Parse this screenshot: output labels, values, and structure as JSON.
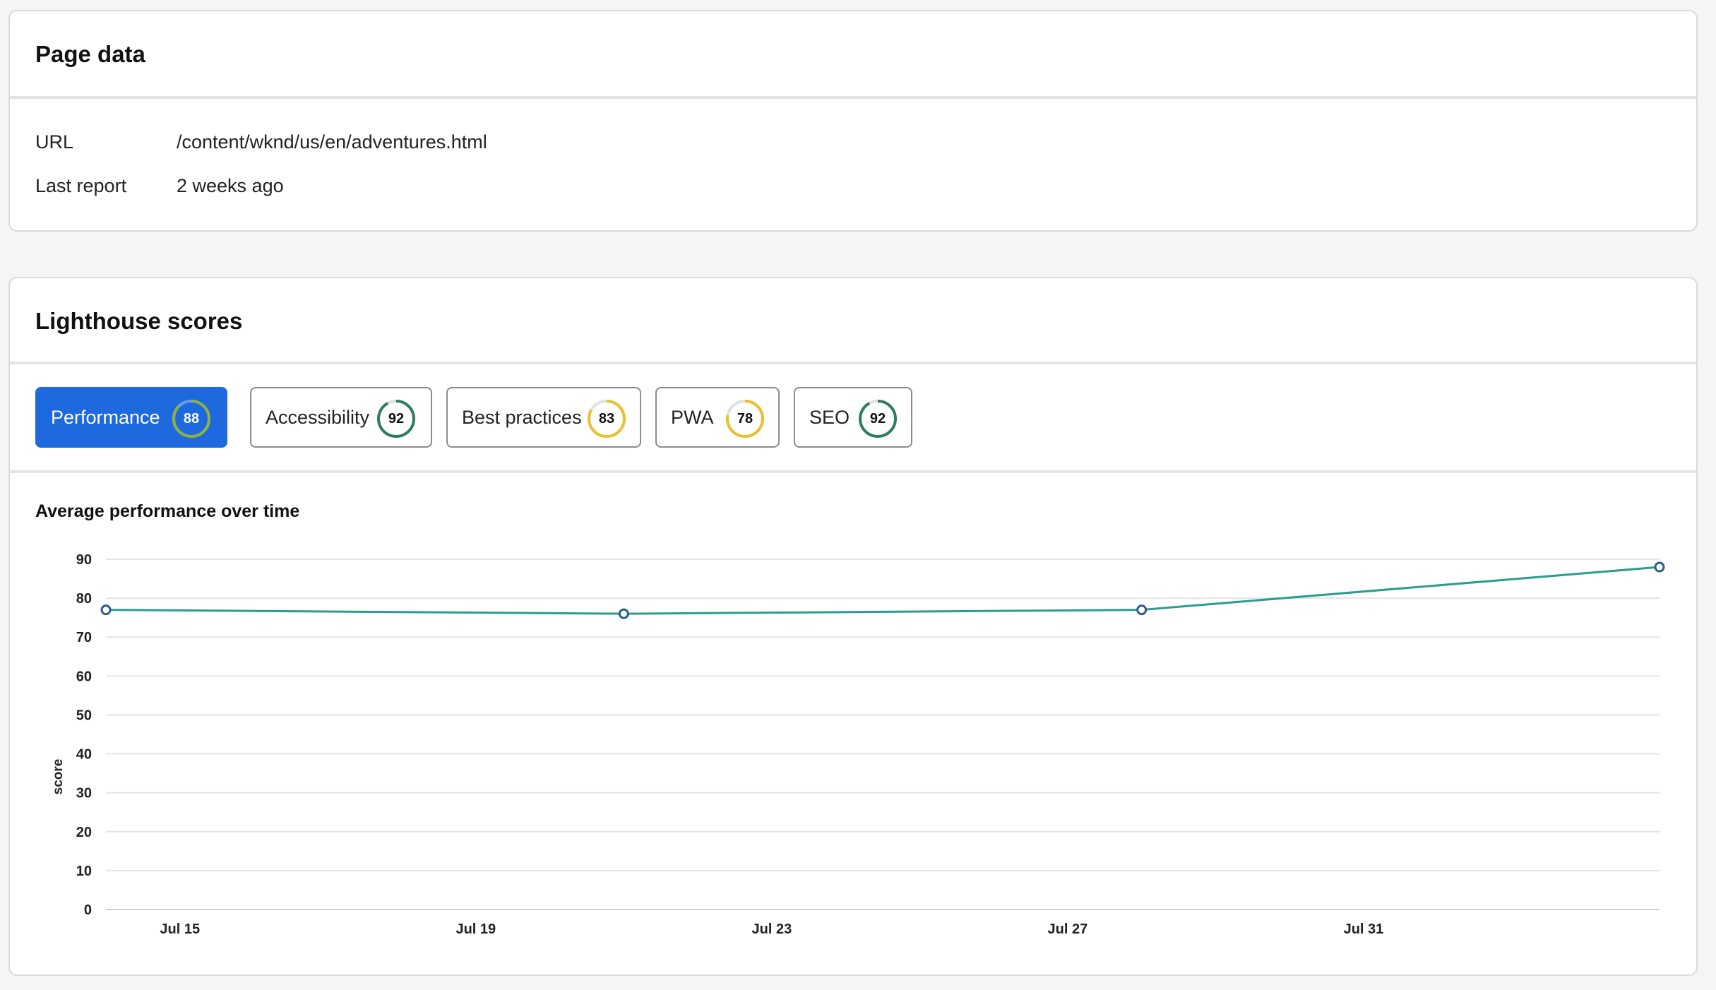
{
  "page_data_card": {
    "title": "Page data",
    "rows": [
      {
        "label": "URL",
        "value": "/content/wknd/us/en/adventures.html"
      },
      {
        "label": "Last report",
        "value": "2 weeks ago"
      }
    ]
  },
  "lighthouse_card": {
    "title": "Lighthouse scores",
    "tabs": [
      {
        "label": "Performance",
        "score": "88",
        "color": "#8bb33f",
        "active": true
      },
      {
        "label": "Accessibility",
        "score": "92",
        "color": "#2e7d5b",
        "active": false
      },
      {
        "label": "Best practices",
        "score": "83",
        "color": "#e8c12c",
        "active": false
      },
      {
        "label": "PWA",
        "score": "78",
        "color": "#e8c12c",
        "active": false
      },
      {
        "label": "SEO",
        "score": "92",
        "color": "#2e7d5b",
        "active": false
      }
    ],
    "chart_title": "Average performance over time"
  },
  "colors": {
    "accent": "#1f69de",
    "line": "#2a9d8f",
    "point_stroke": "#2f5d8a"
  },
  "chart_data": {
    "type": "line",
    "title": "Average performance over time",
    "xlabel": "",
    "ylabel": "score",
    "ylim": [
      0,
      90
    ],
    "yticks": [
      0,
      10,
      20,
      30,
      40,
      50,
      60,
      70,
      80,
      90
    ],
    "xlim": [
      "Jul 14",
      "Aug 4"
    ],
    "xticks": [
      "Jul 15",
      "Jul 19",
      "Jul 23",
      "Jul 27",
      "Jul 31"
    ],
    "grid": true,
    "series": [
      {
        "points": [
          {
            "x": "Jul 14",
            "y": 77
          },
          {
            "x": "Jul 21",
            "y": 76
          },
          {
            "x": "Jul 28",
            "y": 77
          },
          {
            "x": "Aug 4",
            "y": 88
          }
        ]
      }
    ]
  }
}
